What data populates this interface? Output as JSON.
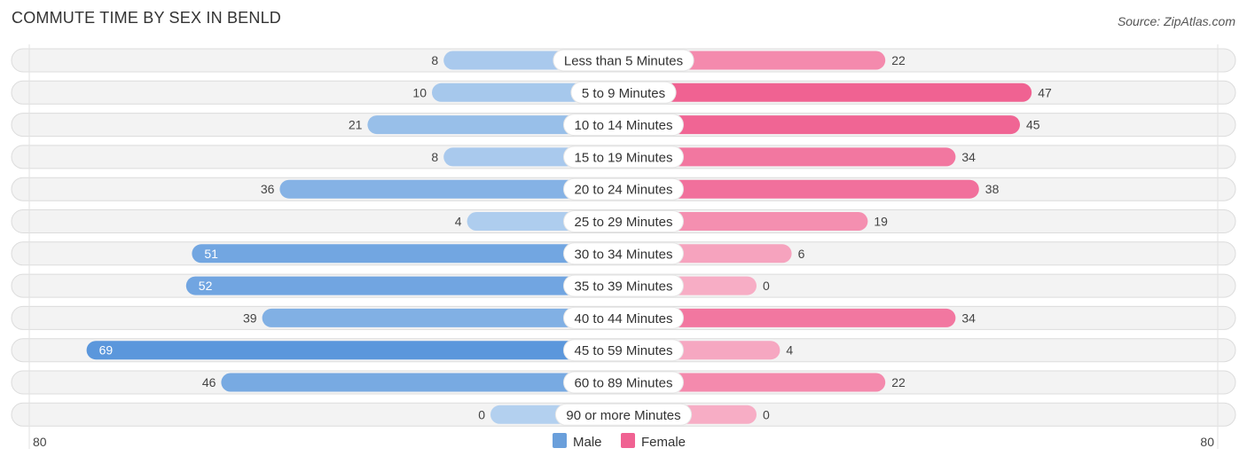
{
  "header": {
    "title": "COMMUTE TIME BY SEX IN BENLD",
    "source": "Source: ZipAtlas.com"
  },
  "chart_data": {
    "type": "bar",
    "orientation": "horizontal-diverging",
    "title": "COMMUTE TIME BY SEX IN BENLD",
    "categories": [
      "Less than 5 Minutes",
      "5 to 9 Minutes",
      "10 to 14 Minutes",
      "15 to 19 Minutes",
      "20 to 24 Minutes",
      "25 to 29 Minutes",
      "30 to 34 Minutes",
      "35 to 39 Minutes",
      "40 to 44 Minutes",
      "45 to 59 Minutes",
      "60 to 89 Minutes",
      "90 or more Minutes"
    ],
    "series": [
      {
        "name": "Male",
        "color": "#6a9fdb",
        "values": [
          8,
          10,
          21,
          8,
          36,
          4,
          51,
          52,
          39,
          69,
          46,
          0
        ]
      },
      {
        "name": "Female",
        "color": "#f06292",
        "values": [
          22,
          47,
          45,
          34,
          38,
          19,
          6,
          0,
          34,
          4,
          22,
          0
        ]
      }
    ],
    "xlim": [
      -80,
      80
    ],
    "axis_labels": {
      "left": "80",
      "right": "80"
    },
    "legend": {
      "position": "bottom-center",
      "items": [
        "Male",
        "Female"
      ]
    }
  }
}
